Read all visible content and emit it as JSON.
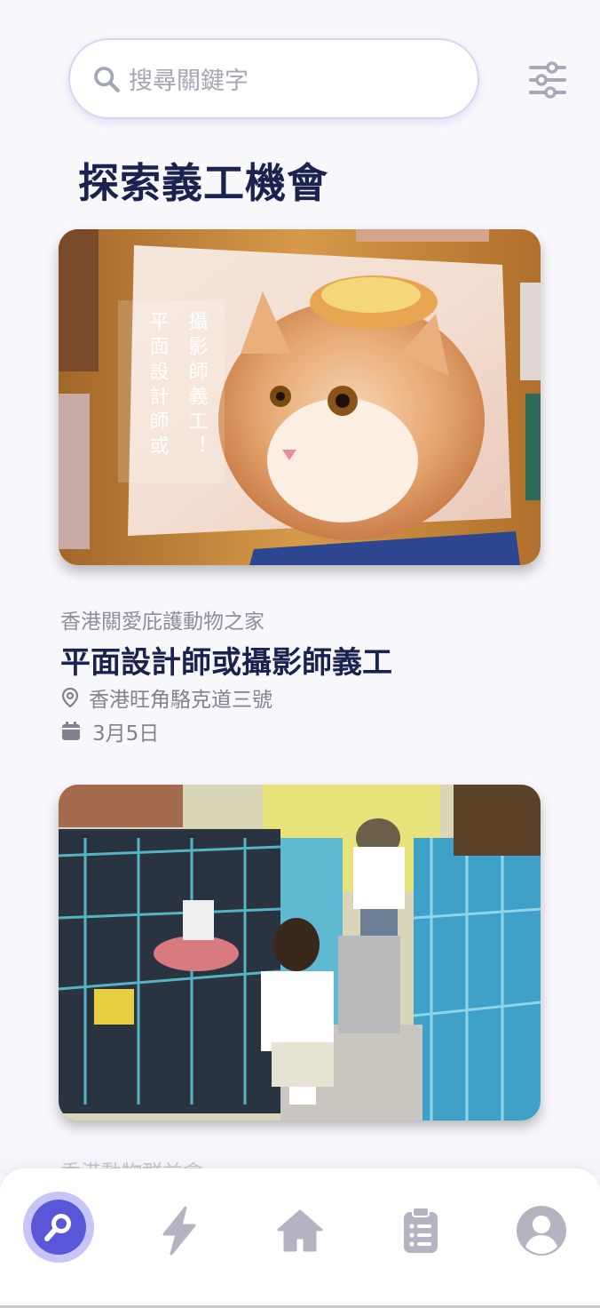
{
  "search": {
    "placeholder": "搜尋關鍵字"
  },
  "page_title": "探索義工機會",
  "cards": [
    {
      "image_text_left": "平面設計師或",
      "image_text_right": "攝影師義工！",
      "organization": "香港關愛庇護動物之家",
      "title": "平面設計師或攝影師義工",
      "location": "香港旺角駱克道三號",
      "date": "3月5日"
    },
    {
      "organization": "香港動物群益會"
    }
  ],
  "bottom_nav": {
    "items": [
      {
        "icon": "search-icon",
        "active": true
      },
      {
        "icon": "lightning-icon",
        "active": false
      },
      {
        "icon": "home-icon",
        "active": false
      },
      {
        "icon": "clipboard-icon",
        "active": false
      },
      {
        "icon": "user-icon",
        "active": false
      }
    ]
  },
  "colors": {
    "primary": "#5a56d8",
    "active_halo": "#c7c4f7",
    "title": "#1b2250",
    "inactive_icon": "#b3b3c2"
  }
}
